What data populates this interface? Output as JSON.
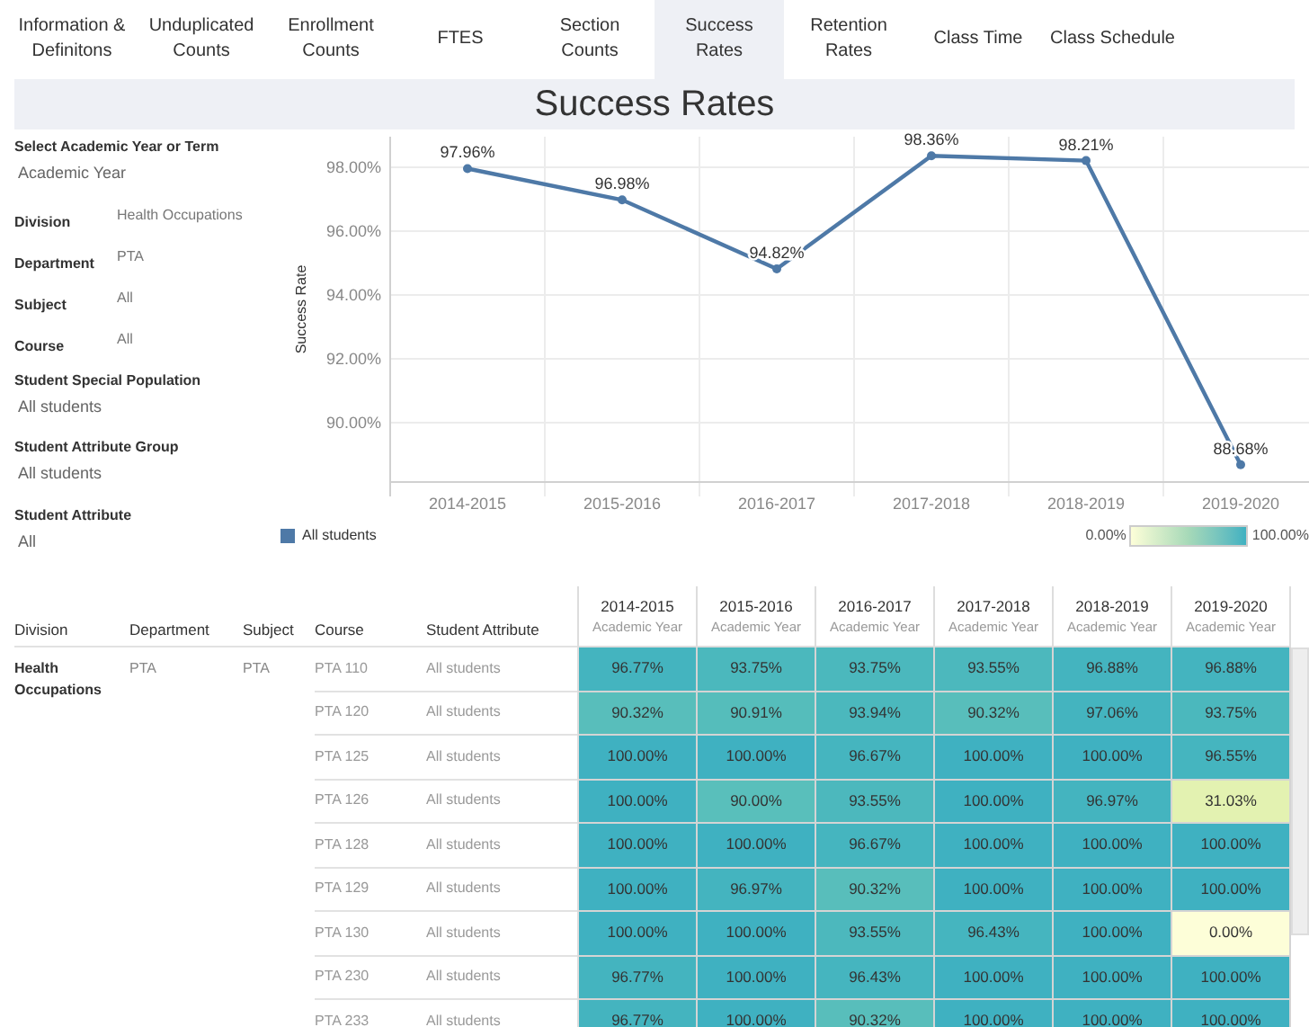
{
  "tabs": [
    {
      "label": "Information & Definitons",
      "selected": false
    },
    {
      "label": "Unduplicated Counts",
      "selected": false
    },
    {
      "label": "Enrollment Counts",
      "selected": false
    },
    {
      "label": "FTES",
      "selected": false
    },
    {
      "label": "Section Counts",
      "selected": false
    },
    {
      "label": "Success Rates",
      "selected": true
    },
    {
      "label": "Retention Rates",
      "selected": false
    },
    {
      "label": "Class Time",
      "selected": false
    },
    {
      "label": "Class Schedule",
      "selected": false
    }
  ],
  "title": "Success Rates",
  "filters": [
    {
      "kind": "stacked",
      "label": "Select Academic Year or Term",
      "value": "Academic Year"
    },
    {
      "kind": "inline",
      "label": "Division",
      "value": "Health Occupations"
    },
    {
      "kind": "inline",
      "label": "Department",
      "value": "PTA"
    },
    {
      "kind": "inline",
      "label": "Subject",
      "value": "All"
    },
    {
      "kind": "inline",
      "label": "Course",
      "value": "All"
    },
    {
      "kind": "stacked",
      "label": "Student Special Population",
      "value": "All students"
    },
    {
      "kind": "stacked",
      "label": "Student Attribute Group",
      "value": "All students"
    },
    {
      "kind": "stacked",
      "label": "Student Attribute",
      "value": "All"
    }
  ],
  "chart": {
    "chart_data": {
      "type": "line",
      "ylabel": "Success Rate",
      "categories": [
        "2014-2015",
        "2015-2016",
        "2016-2017",
        "2017-2018",
        "2018-2019",
        "2019-2020"
      ],
      "series": [
        {
          "name": "All students",
          "color": "#4e79a7",
          "marker": true,
          "values": [
            97.96,
            96.98,
            94.82,
            98.36,
            98.21,
            88.68
          ]
        }
      ],
      "ylim": [
        88.14,
        98.96
      ],
      "grid": true,
      "yticks": [
        {
          "value": 90,
          "label": "90.00%"
        },
        {
          "value": 92,
          "label": "92.00%"
        },
        {
          "value": 94,
          "label": "94.00%"
        },
        {
          "value": 96,
          "label": "96.00%"
        },
        {
          "value": 98,
          "label": "98.00%"
        }
      ],
      "value_labels": [
        "97.96%",
        "96.98%",
        "94.82%",
        "98.36%",
        "98.21%",
        "88.68%"
      ]
    },
    "color_legend": {
      "min": "0.00%",
      "max": "100.00%"
    }
  },
  "table": {
    "columns": [
      "Division",
      "Department",
      "Subject",
      "Course",
      "Student Attribute"
    ],
    "years": [
      {
        "year": "2014-2015",
        "sub": "Academic Year"
      },
      {
        "year": "2015-2016",
        "sub": "Academic Year"
      },
      {
        "year": "2016-2017",
        "sub": "Academic Year"
      },
      {
        "year": "2017-2018",
        "sub": "Academic Year"
      },
      {
        "year": "2018-2019",
        "sub": "Academic Year"
      },
      {
        "year": "2019-2020",
        "sub": "Academic Year"
      }
    ],
    "group": {
      "division": "Health Occupations",
      "department": "PTA",
      "subject": "PTA"
    },
    "rows": [
      {
        "course": "PTA 110",
        "attribute": "All students",
        "cells": [
          {
            "text": "96.77%",
            "color": "#44b4bf"
          },
          {
            "text": "93.75%",
            "color": "#4bb8bd"
          },
          {
            "text": "93.75%",
            "color": "#4bb8bd"
          },
          {
            "text": "93.55%",
            "color": "#4cb8bd"
          },
          {
            "text": "96.88%",
            "color": "#44b4bf"
          },
          {
            "text": "96.88%",
            "color": "#44b4bf"
          }
        ]
      },
      {
        "course": "PTA 120",
        "attribute": "All students",
        "cells": [
          {
            "text": "90.32%",
            "color": "#58bebb"
          },
          {
            "text": "90.91%",
            "color": "#55bdbb"
          },
          {
            "text": "93.94%",
            "color": "#4bb8bd"
          },
          {
            "text": "90.32%",
            "color": "#58bebb"
          },
          {
            "text": "97.06%",
            "color": "#44b4bf"
          },
          {
            "text": "93.75%",
            "color": "#4bb8bd"
          }
        ]
      },
      {
        "course": "PTA 125",
        "attribute": "All students",
        "cells": [
          {
            "text": "100.00%",
            "color": "#3fb1c1"
          },
          {
            "text": "100.00%",
            "color": "#3fb1c1"
          },
          {
            "text": "96.67%",
            "color": "#45b5bf"
          },
          {
            "text": "100.00%",
            "color": "#3fb1c1"
          },
          {
            "text": "100.00%",
            "color": "#3fb1c1"
          },
          {
            "text": "96.55%",
            "color": "#45b5bf"
          }
        ]
      },
      {
        "course": "PTA 126",
        "attribute": "All students",
        "cells": [
          {
            "text": "100.00%",
            "color": "#3fb1c1"
          },
          {
            "text": "90.00%",
            "color": "#59bfbb"
          },
          {
            "text": "93.55%",
            "color": "#4cb8bd"
          },
          {
            "text": "100.00%",
            "color": "#3fb1c1"
          },
          {
            "text": "96.97%",
            "color": "#44b4bf"
          },
          {
            "text": "31.03%",
            "color": "#e3f2b1"
          }
        ]
      },
      {
        "course": "PTA 128",
        "attribute": "All students",
        "cells": [
          {
            "text": "100.00%",
            "color": "#3fb1c1"
          },
          {
            "text": "100.00%",
            "color": "#3fb1c1"
          },
          {
            "text": "96.67%",
            "color": "#45b5bf"
          },
          {
            "text": "100.00%",
            "color": "#3fb1c1"
          },
          {
            "text": "100.00%",
            "color": "#3fb1c1"
          },
          {
            "text": "100.00%",
            "color": "#3fb1c1"
          }
        ]
      },
      {
        "course": "PTA 129",
        "attribute": "All students",
        "cells": [
          {
            "text": "100.00%",
            "color": "#3fb1c1"
          },
          {
            "text": "96.97%",
            "color": "#44b4bf"
          },
          {
            "text": "90.32%",
            "color": "#58bebb"
          },
          {
            "text": "100.00%",
            "color": "#3fb1c1"
          },
          {
            "text": "100.00%",
            "color": "#3fb1c1"
          },
          {
            "text": "100.00%",
            "color": "#3fb1c1"
          }
        ]
      },
      {
        "course": "PTA 130",
        "attribute": "All students",
        "cells": [
          {
            "text": "100.00%",
            "color": "#3fb1c1"
          },
          {
            "text": "100.00%",
            "color": "#3fb1c1"
          },
          {
            "text": "93.55%",
            "color": "#4cb8bd"
          },
          {
            "text": "96.43%",
            "color": "#45b5bf"
          },
          {
            "text": "100.00%",
            "color": "#3fb1c1"
          },
          {
            "text": "0.00%",
            "color": "#fdfed8"
          }
        ]
      },
      {
        "course": "PTA 230",
        "attribute": "All students",
        "cells": [
          {
            "text": "96.77%",
            "color": "#44b4bf"
          },
          {
            "text": "100.00%",
            "color": "#3fb1c1"
          },
          {
            "text": "96.43%",
            "color": "#45b5bf"
          },
          {
            "text": "100.00%",
            "color": "#3fb1c1"
          },
          {
            "text": "100.00%",
            "color": "#3fb1c1"
          },
          {
            "text": "100.00%",
            "color": "#3fb1c1"
          }
        ]
      },
      {
        "course": "PTA 233",
        "attribute": "All students",
        "cells": [
          {
            "text": "96.77%",
            "color": "#44b4bf"
          },
          {
            "text": "100.00%",
            "color": "#3fb1c1"
          },
          {
            "text": "90.32%",
            "color": "#58bebb"
          },
          {
            "text": "100.00%",
            "color": "#3fb1c1"
          },
          {
            "text": "100.00%",
            "color": "#3fb1c1"
          },
          {
            "text": "100.00%",
            "color": "#3fb1c1"
          }
        ]
      }
    ]
  }
}
